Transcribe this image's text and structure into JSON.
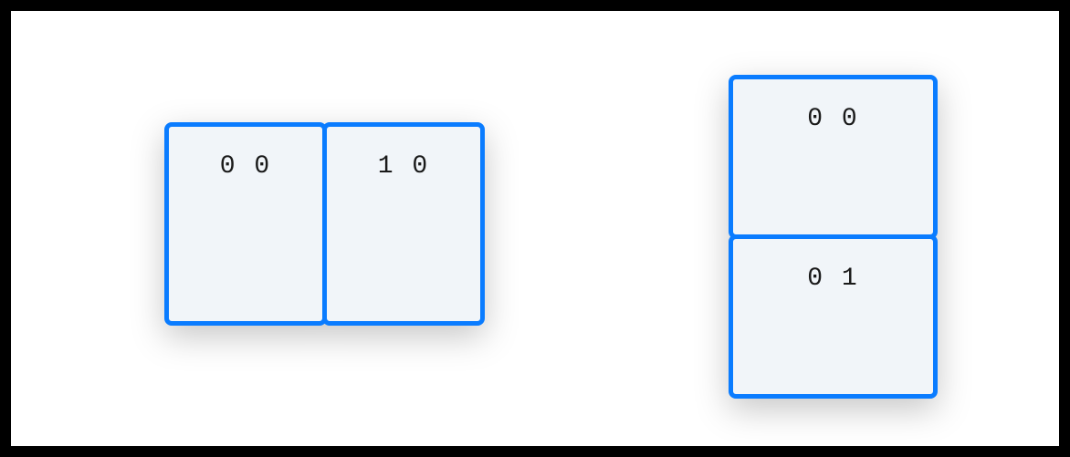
{
  "groups": {
    "horizontal": {
      "cells": [
        {
          "label": "0 0"
        },
        {
          "label": "1 0"
        }
      ]
    },
    "vertical": {
      "cells": [
        {
          "label": "0 0"
        },
        {
          "label": "0 1"
        }
      ]
    }
  }
}
